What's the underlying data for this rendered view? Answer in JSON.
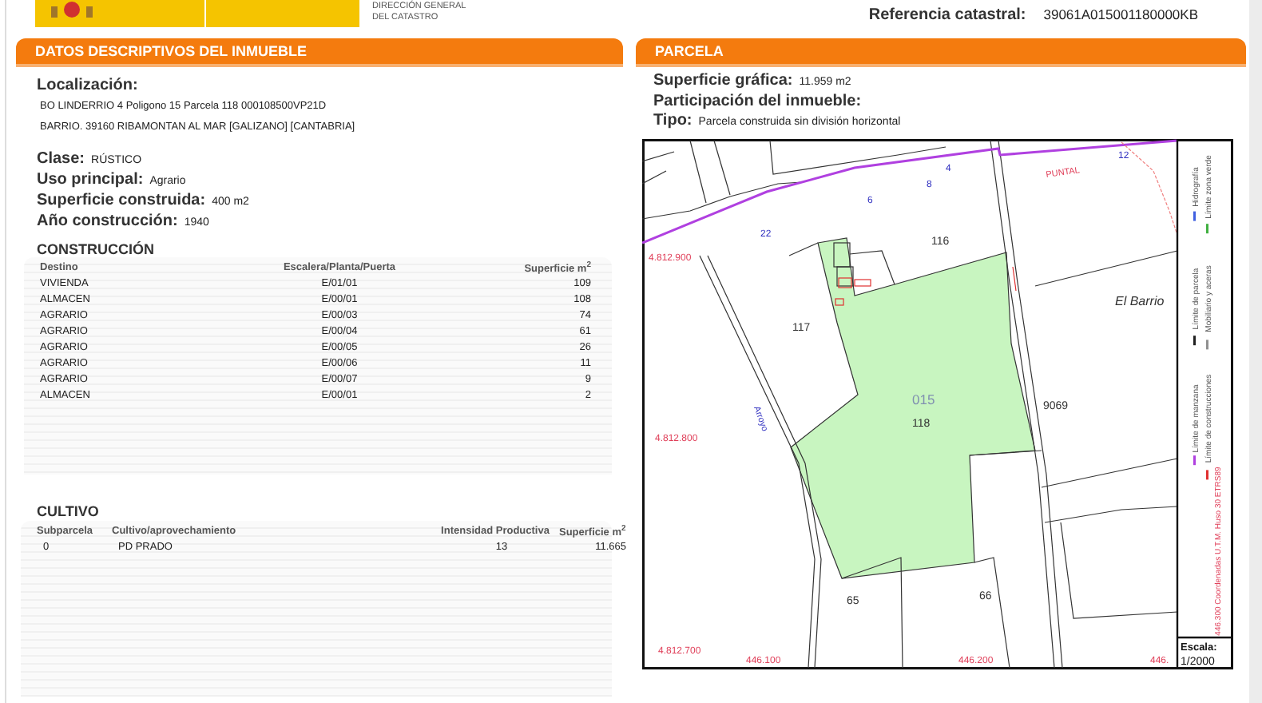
{
  "header": {
    "org_lines": [
      "DIRECCIÓN GENERAL",
      "DEL CATASTRO"
    ],
    "reference_label": "Referencia catastral:",
    "reference_value": "39061A015001180000KB"
  },
  "descriptive": {
    "title": "DATOS DESCRIPTIVOS DEL INMUEBLE",
    "location": {
      "label": "Localización:",
      "lines": [
        "BO LINDERRIO 4 Poligono 15 Parcela 118 000108500VP21D",
        "BARRIO. 39160 RIBAMONTAN AL MAR [GALIZANO] [CANTABRIA]"
      ]
    },
    "fields": [
      {
        "label": "Clase:",
        "value": "RÚSTICO"
      },
      {
        "label": "Uso principal:",
        "value": "Agrario"
      },
      {
        "label": "Superficie construida:",
        "value": "400 m2"
      },
      {
        "label": "Año construcción:",
        "value": "1940"
      }
    ],
    "construction": {
      "title": "CONSTRUCCIÓN",
      "columns": [
        "Destino",
        "Escalera/Planta/Puerta",
        "Superficie m$^{2}$"
      ],
      "rows": [
        [
          "VIVIENDA",
          "E/01/01",
          "109"
        ],
        [
          "ALMACEN",
          "E/00/01",
          "108"
        ],
        [
          "AGRARIO",
          "E/00/03",
          "74"
        ],
        [
          "AGRARIO",
          "E/00/04",
          "61"
        ],
        [
          "AGRARIO",
          "E/00/05",
          "26"
        ],
        [
          "AGRARIO",
          "E/00/06",
          "11"
        ],
        [
          "AGRARIO",
          "E/00/07",
          "9"
        ],
        [
          "ALMACEN",
          "E/00/01",
          "2"
        ]
      ]
    },
    "cultivation": {
      "title": "CULTIVO",
      "columns": [
        "Subparcela",
        "Cultivo/aprovechamiento",
        "Intensidad Productiva",
        "Superficie m$^{2}$"
      ],
      "rows": [
        [
          "0",
          "PD PRADO",
          "13",
          "11.665"
        ]
      ]
    }
  },
  "parcel": {
    "title": "PARCELA",
    "fields": [
      {
        "label": "Superficie gráfica:",
        "value": "11.959 m2"
      },
      {
        "label": "Participación del inmueble:"
      },
      {
        "label": "Tipo:",
        "value": "Parcela construida sin división horizontal"
      }
    ],
    "map": {
      "labels": [
        {
          "text": "4",
          "kind": "line"
        },
        {
          "text": "12",
          "kind": "line"
        },
        {
          "text": "8",
          "kind": "line"
        },
        {
          "text": "6",
          "kind": "line"
        },
        {
          "text": "22",
          "kind": "line"
        },
        {
          "text": "PUNTAL",
          "kind": "toponym"
        },
        {
          "text": "4.812.900",
          "kind": "coordinate"
        },
        {
          "text": "116",
          "kind": "parcel"
        },
        {
          "text": "117",
          "kind": "parcel"
        },
        {
          "text": "El Barrio",
          "kind": "place"
        },
        {
          "text": "015",
          "kind": "polygon"
        },
        {
          "text": "118",
          "kind": "parcel"
        },
        {
          "text": "9069",
          "kind": "parcel"
        },
        {
          "text": "Arroyo",
          "kind": "stream"
        },
        {
          "text": "4.812.800",
          "kind": "coordinate"
        },
        {
          "text": "65",
          "kind": "parcel"
        },
        {
          "text": "66",
          "kind": "parcel"
        },
        {
          "text": "4.812.700",
          "kind": "coordinate"
        },
        {
          "text": "446.100",
          "kind": "coordinate"
        },
        {
          "text": "446.200",
          "kind": "coordinate"
        },
        {
          "text": "446.",
          "kind": "coordinate"
        }
      ],
      "legend": [
        {
          "text": "Hidrografía",
          "color": "#4060e0"
        },
        {
          "text": "Límite zona verde",
          "color": "#40b040"
        },
        {
          "text": "Límite de parcela",
          "color": "#202020"
        },
        {
          "text": "Mobiliario y aceras",
          "color": "#909090"
        },
        {
          "text": "Límite de manzana",
          "color": "#b040e0"
        },
        {
          "text": "Límite de construcciones",
          "color": "#e03030"
        }
      ],
      "coordinate_note": "446.300 Coordenadas U.T.M. Huso 30 ETRS89",
      "scale_label": "Escala:",
      "scale_value": "1/2000"
    }
  }
}
